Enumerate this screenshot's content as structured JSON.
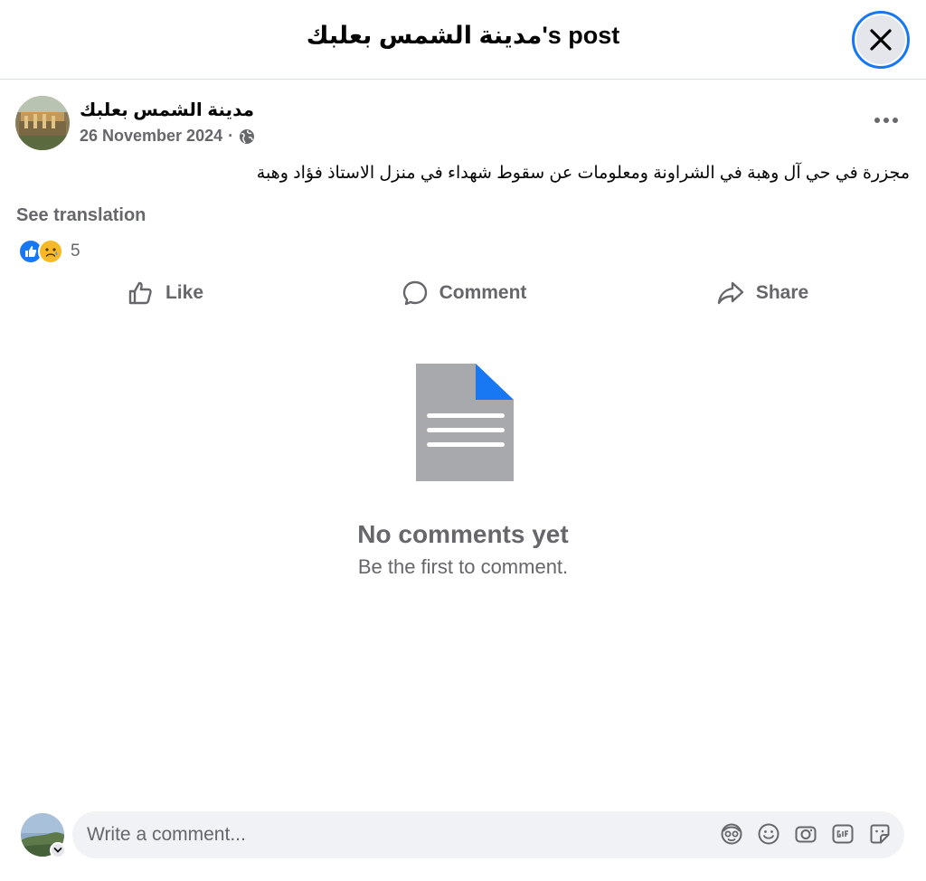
{
  "header": {
    "title": "مدينة الشمس بعلبك's post"
  },
  "post": {
    "author": "مدينة الشمس بعلبك",
    "date": "26 November 2024",
    "separator": "·",
    "privacy_icon": "globe-icon",
    "text": "مجزرة في حي آل وهبة في الشراونة ومعلومات عن سقوط شهداء في منزل الاستاذ فؤاد وهبة",
    "see_translation": "See translation",
    "reactions": {
      "icons": [
        "like-reaction-icon",
        "sad-reaction-icon"
      ],
      "count": "5"
    }
  },
  "actions": {
    "like": "Like",
    "comment": "Comment",
    "share": "Share"
  },
  "empty_state": {
    "title": "No comments yet",
    "subtitle": "Be the first to comment."
  },
  "composer": {
    "placeholder": "Write a comment...",
    "icons": [
      "avatar-sticker-icon",
      "emoji-icon",
      "camera-icon",
      "gif-icon",
      "sticker-icon"
    ]
  },
  "colors": {
    "accent": "#1877f2",
    "secondary_text": "#65676b",
    "input_bg": "#f0f2f5",
    "doc_gray": "#a8a9ad"
  }
}
